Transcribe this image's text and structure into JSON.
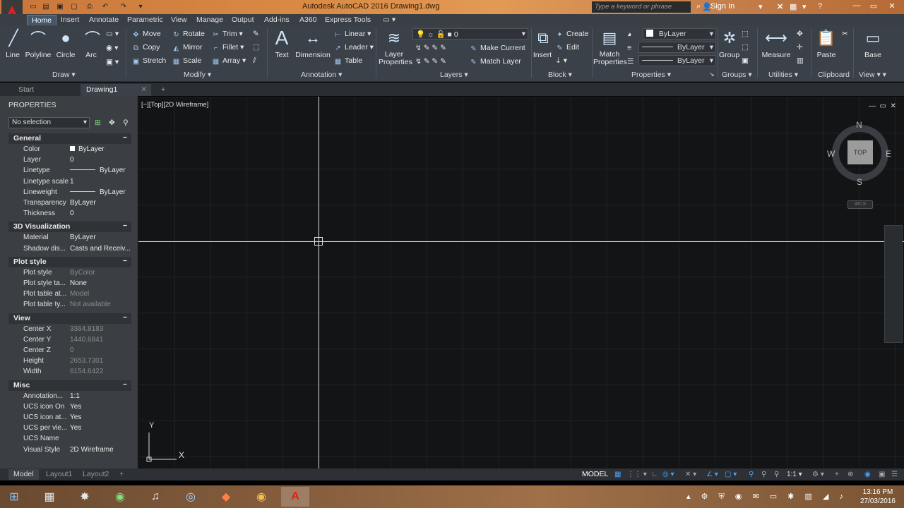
{
  "titlebar": {
    "app_title": "Autodesk AutoCAD 2016   Drawing1.dwg",
    "search_placeholder": "Type a keyword or phrase",
    "signin": "Sign In"
  },
  "ribbon_tabs": [
    "Home",
    "Insert",
    "Annotate",
    "Parametric",
    "View",
    "Manage",
    "Output",
    "Add-ins",
    "A360",
    "Express Tools"
  ],
  "draw": {
    "line": "Line",
    "polyline": "Polyline",
    "circle": "Circle",
    "arc": "Arc",
    "label": "Draw"
  },
  "modify": {
    "move": "Move",
    "rotate": "Rotate",
    "trim": "Trim",
    "copy": "Copy",
    "mirror": "Mirror",
    "fillet": "Fillet",
    "stretch": "Stretch",
    "scale": "Scale",
    "array": "Array",
    "label": "Modify"
  },
  "annotation": {
    "text": "Text",
    "dimension": "Dimension",
    "linear": "Linear",
    "leader": "Leader",
    "table": "Table",
    "label": "Annotation"
  },
  "layers": {
    "layer_properties": "Layer Properties",
    "layer_value": "0",
    "make_current": "Make Current",
    "match_layer": "Match Layer",
    "label": "Layers"
  },
  "block": {
    "insert": "Insert",
    "create": "Create",
    "edit": "Edit",
    "label": "Block"
  },
  "properties_panel": {
    "match_properties": "Match Properties",
    "color": "ByLayer",
    "lineweight": "ByLayer",
    "linetype": "ByLayer",
    "label": "Properties"
  },
  "groups": {
    "group": "Group",
    "label": "Groups"
  },
  "utilities": {
    "measure": "Measure",
    "label": "Utilities"
  },
  "clipboard": {
    "paste": "Paste",
    "label": "Clipboard"
  },
  "view_panel": {
    "base": "Base",
    "label": "View"
  },
  "filetabs": [
    "Start",
    "Drawing1"
  ],
  "props": {
    "header": "PROPERTIES",
    "selection": "No selection",
    "general": {
      "title": "General",
      "rows": [
        [
          "Color",
          "ByLayer"
        ],
        [
          "Layer",
          "0"
        ],
        [
          "Linetype",
          "ByLayer"
        ],
        [
          "Linetype scale",
          "1"
        ],
        [
          "Lineweight",
          "ByLayer"
        ],
        [
          "Transparency",
          "ByLayer"
        ],
        [
          "Thickness",
          "0"
        ]
      ]
    },
    "viz": {
      "title": "3D Visualization",
      "rows": [
        [
          "Material",
          "ByLayer"
        ],
        [
          "Shadow dis...",
          "Casts and Receiv..."
        ]
      ]
    },
    "plot": {
      "title": "Plot style",
      "rows": [
        [
          "Plot style",
          "ByColor"
        ],
        [
          "Plot style ta...",
          "None"
        ],
        [
          "Plot table at...",
          "Model"
        ],
        [
          "Plot table ty...",
          "Not available"
        ]
      ]
    },
    "view": {
      "title": "View",
      "rows": [
        [
          "Center X",
          "3364.8183"
        ],
        [
          "Center Y",
          "1440.6841"
        ],
        [
          "Center Z",
          "0"
        ],
        [
          "Height",
          "2653.7301"
        ],
        [
          "Width",
          "6154.6422"
        ]
      ]
    },
    "misc": {
      "title": "Misc",
      "rows": [
        [
          "Annotation...",
          "1:1"
        ],
        [
          "UCS icon On",
          "Yes"
        ],
        [
          "UCS icon at...",
          "Yes"
        ],
        [
          "UCS per vie...",
          "Yes"
        ],
        [
          "UCS Name",
          ""
        ],
        [
          "Visual Style",
          "2D Wireframe"
        ]
      ]
    }
  },
  "viewport": {
    "label": "[−][Top][2D Wireframe]",
    "top": "TOP",
    "n": "N",
    "s": "S",
    "e": "E",
    "w": "W",
    "wcs": "WCS",
    "ucs_x": "X",
    "ucs_y": "Y"
  },
  "layouts": [
    "Model",
    "Layout1",
    "Layout2"
  ],
  "status": {
    "model": "MODEL",
    "scale": "1:1"
  },
  "clock": {
    "time": "13:16 PM",
    "date": "27/03/2016"
  }
}
